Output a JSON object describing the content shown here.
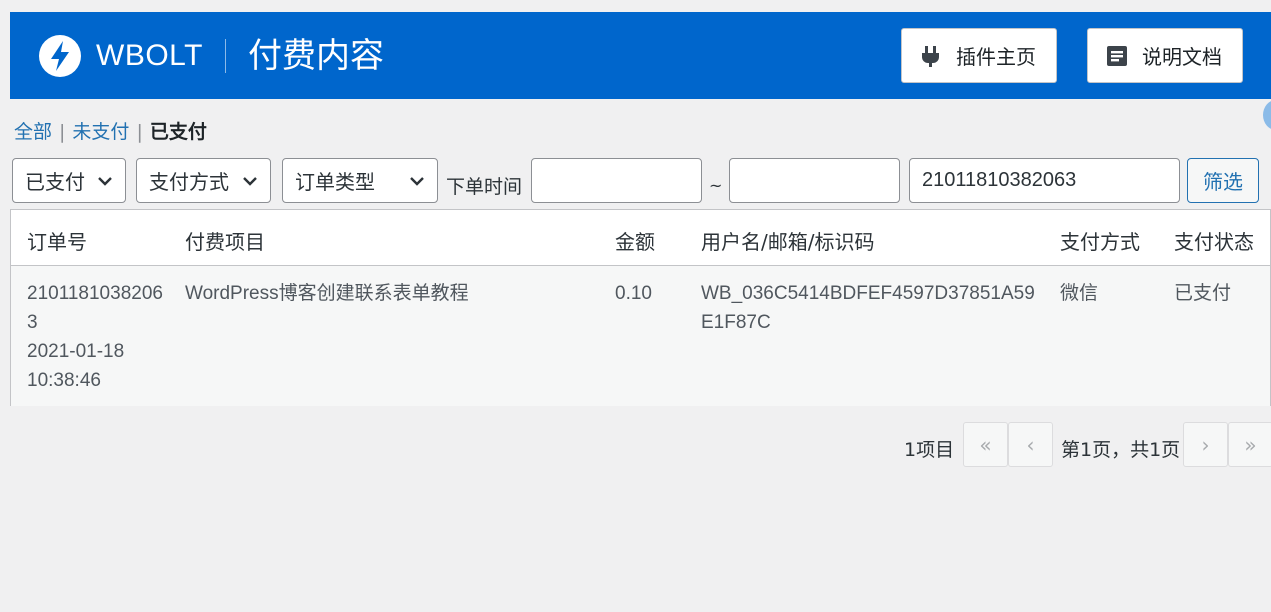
{
  "header": {
    "brand": "WBOLT",
    "title": "付费内容",
    "plugin_home_label": "插件主页",
    "docs_label": "说明文档",
    "bg_color": "#0066cc"
  },
  "filters_nav": {
    "all": "全部",
    "unpaid": "未支付",
    "paid": "已支付",
    "separator": "|"
  },
  "toolbar": {
    "status_select": "已支付",
    "pay_method_select": "支付方式",
    "order_type_select": "订单类型",
    "time_label": "下单时间",
    "time_from": "",
    "tilde": "~",
    "time_to": "",
    "order_no": "21011810382063",
    "filter_label": "筛选"
  },
  "table": {
    "columns": [
      "订单号",
      "付费项目",
      "金额",
      "用户名/邮箱/标识码",
      "支付方式",
      "支付状态"
    ],
    "rows": [
      {
        "order_no": "21011810382063",
        "date": "2021-01-18",
        "time": "10:38:46",
        "item": "WordPress博客创建联系表单教程",
        "amount": "0.10",
        "user": "WB_036C5414BDFEF4597D37851A59E1F87C",
        "pay_method": "微信",
        "status": "已支付"
      }
    ]
  },
  "pagination": {
    "items_count": "1项目",
    "first": "«",
    "prev": "‹",
    "page_info": "第1页，共1页",
    "next": "›",
    "last": "»"
  },
  "icons": [
    "bolt-logo-icon",
    "plug-icon",
    "document-icon",
    "chevron-down-icon"
  ]
}
